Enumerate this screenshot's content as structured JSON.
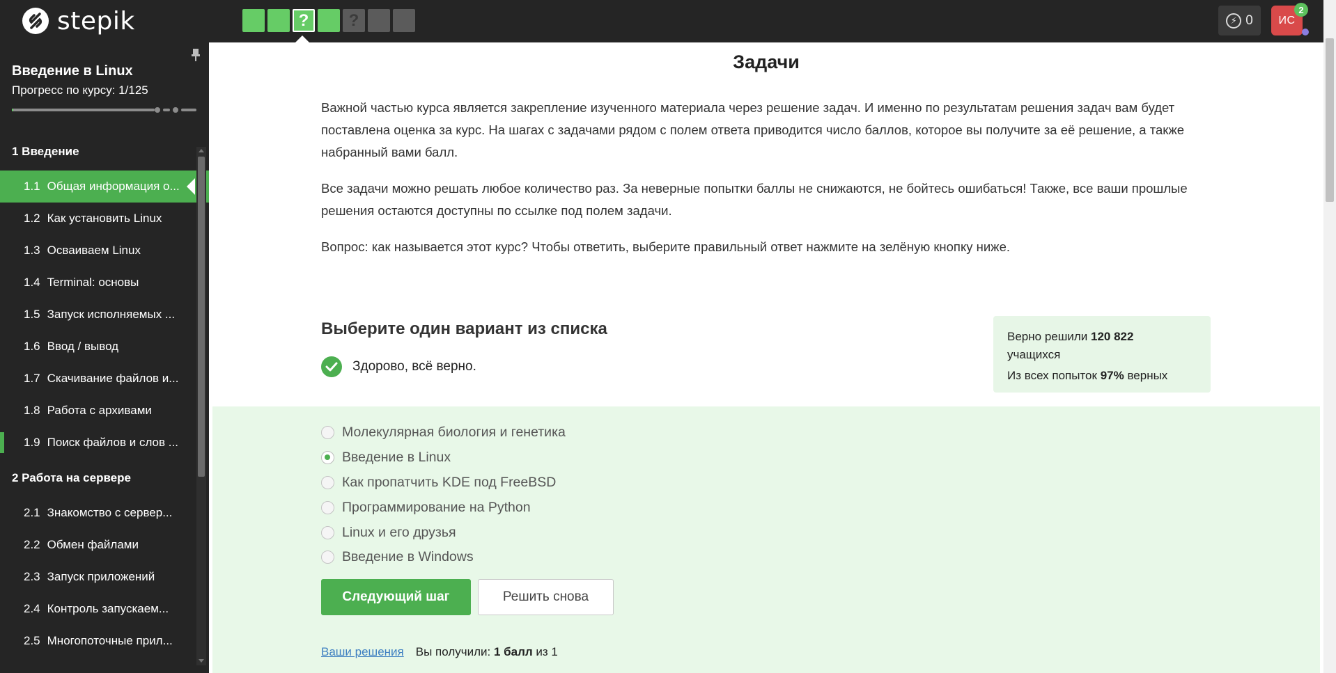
{
  "brand": {
    "logo_text": "stepik"
  },
  "steps": [
    {
      "state": "done",
      "label": ""
    },
    {
      "state": "done",
      "label": ""
    },
    {
      "state": "done",
      "label": "?",
      "current": true
    },
    {
      "state": "done",
      "label": ""
    },
    {
      "state": "pending",
      "label": "?"
    },
    {
      "state": "pending",
      "label": ""
    },
    {
      "state": "pending",
      "label": ""
    }
  ],
  "header": {
    "energy_count": "0",
    "avatar_initials": "ИС",
    "notifications_count": "2"
  },
  "sidebar": {
    "course_title": "Введение в Linux",
    "progress_label": "Прогресс по курсу:  1/125",
    "progress_fraction": 0.008,
    "sections": [
      {
        "label": "1  Введение",
        "lessons": [
          {
            "num": "1.1",
            "title": "Общая информация о...",
            "active": true,
            "marked": true
          },
          {
            "num": "1.2",
            "title": "Как установить Linux",
            "active": false,
            "marked": false
          },
          {
            "num": "1.3",
            "title": "Осваиваем Linux",
            "active": false,
            "marked": false
          },
          {
            "num": "1.4",
            "title": "Terminal: основы",
            "active": false,
            "marked": false
          },
          {
            "num": "1.5",
            "title": "Запуск исполняемых ...",
            "active": false,
            "marked": false
          },
          {
            "num": "1.6",
            "title": "Ввод / вывод",
            "active": false,
            "marked": false
          },
          {
            "num": "1.7",
            "title": "Скачивание файлов и...",
            "active": false,
            "marked": false
          },
          {
            "num": "1.8",
            "title": "Работа с архивами",
            "active": false,
            "marked": false
          },
          {
            "num": "1.9",
            "title": "Поиск файлов и слов ...",
            "active": false,
            "marked": true
          }
        ]
      },
      {
        "label": "2  Работа на сервере",
        "lessons": [
          {
            "num": "2.1",
            "title": "Знакомство с сервер...",
            "active": false,
            "marked": false
          },
          {
            "num": "2.2",
            "title": "Обмен файлами",
            "active": false,
            "marked": false
          },
          {
            "num": "2.3",
            "title": "Запуск приложений",
            "active": false,
            "marked": false
          },
          {
            "num": "2.4",
            "title": "Контроль запускаем...",
            "active": false,
            "marked": false
          },
          {
            "num": "2.5",
            "title": "Многопоточные прил...",
            "active": false,
            "marked": false
          }
        ]
      }
    ]
  },
  "main": {
    "title": "Задачи",
    "paragraphs": [
      "Важной частью курса является закрепление изученного материала через решение задач. И именно по результатам решения задач вам будет поставлена оценка за курс. На шагах с задачами рядом с полем ответа приводится число баллов, которое вы получите за её решение, а также набранный вами балл.",
      "Все задачи можно решать любое количество раз. За неверные попытки баллы не снижаются, не бойтесь ошибаться! Также, все ваши прошлые решения остаются доступны по ссылке под полем задачи.",
      "Вопрос: как называется этот курс? Чтобы ответить, выберите правильный ответ нажмите на зелёную кнопку ниже."
    ],
    "quiz": {
      "header": "Выберите один вариант из списка",
      "result_text": "Здорово, всё верно.",
      "stats": {
        "solved_prefix": "Верно решили ",
        "solved_count": "120 822",
        "solved_suffix": "учащихся",
        "attempts_prefix": "Из всех попыток ",
        "attempts_percent": "97%",
        "attempts_suffix": " верных"
      },
      "options": [
        {
          "label": "Молекулярная биология и генетика",
          "checked": false
        },
        {
          "label": "Введение в Linux",
          "checked": true
        },
        {
          "label": "Как пропатчить KDE под FreeBSD",
          "checked": false
        },
        {
          "label": "Программирование на Python",
          "checked": false
        },
        {
          "label": "Linux и его друзья",
          "checked": false
        },
        {
          "label": "Введение в Windows",
          "checked": false
        }
      ],
      "next_button": "Следующий шаг",
      "retry_button": "Решить снова",
      "your_solutions_link": "Ваши решения",
      "score_prefix": "Вы получили: ",
      "score_value": "1 балл",
      "score_suffix": " из 1"
    }
  }
}
